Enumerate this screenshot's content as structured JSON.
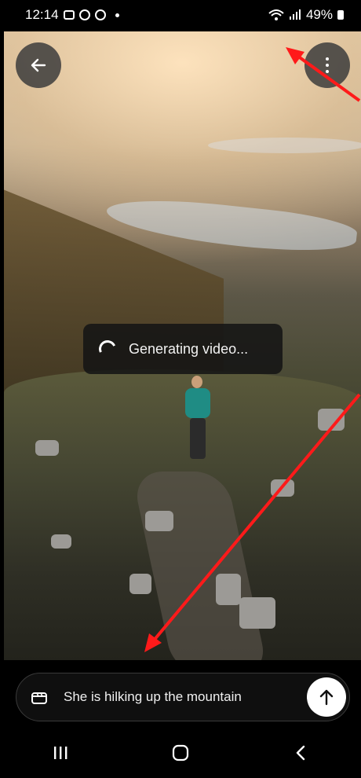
{
  "status_bar": {
    "time": "12:14",
    "battery_pct": "49%"
  },
  "toast": {
    "text": "Generating video..."
  },
  "prompt": {
    "text": "She is hilking up the mountain"
  },
  "icons": {
    "back": "arrow-left-icon",
    "more": "kebab-menu-icon",
    "clapper": "clapperboard-icon",
    "send": "arrow-up-icon",
    "nav_recents": "recents-icon",
    "nav_home": "home-icon",
    "nav_back": "chevron-left-icon"
  },
  "colors": {
    "annotation": "#ff1a1a",
    "teal_jacket": "#1f8c84"
  }
}
